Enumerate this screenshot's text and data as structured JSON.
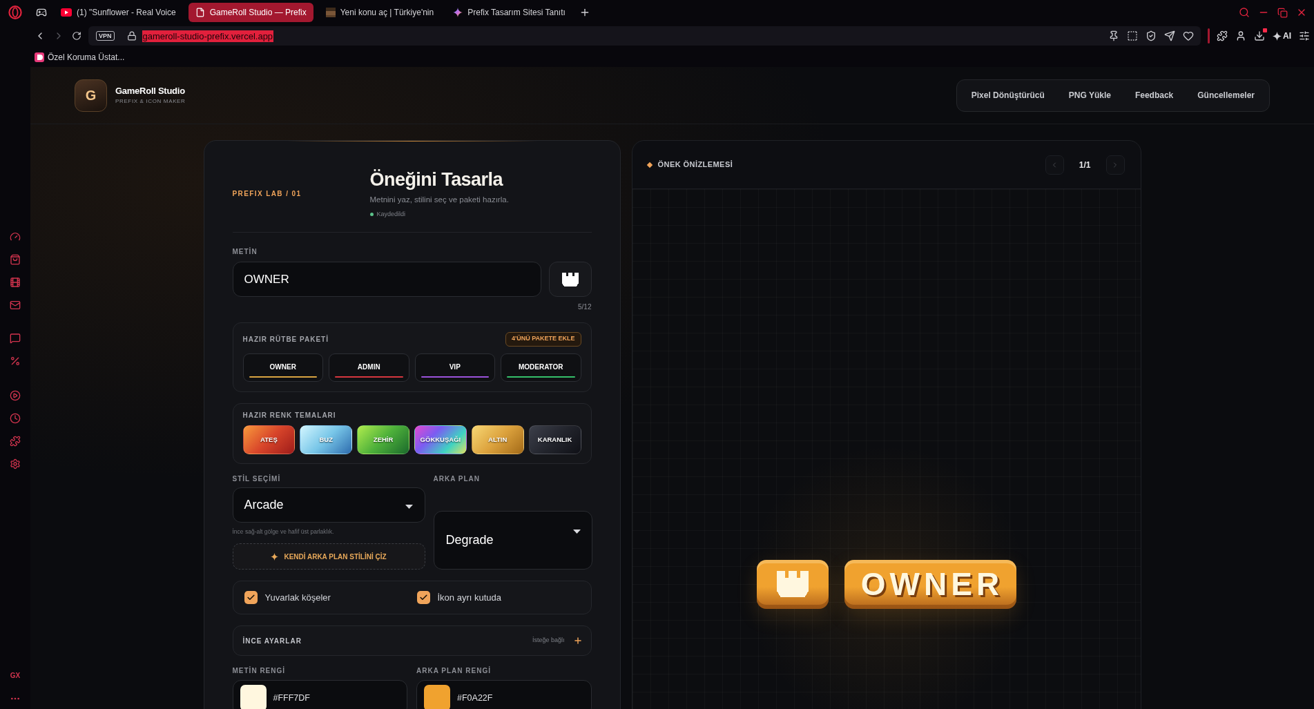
{
  "browser": {
    "tabs": [
      {
        "kind": "video",
        "title": "(1) \"Sunflower - Real Voice",
        "selected": false
      },
      {
        "kind": "page",
        "title": "GameRoll Studio — Prefix",
        "selected": true
      },
      {
        "kind": "game",
        "title": "Yeni konu aç | Türkiye'nin",
        "selected": false
      },
      {
        "kind": "ai",
        "title": "Prefix Tasarım Sitesi Tanıtı",
        "selected": false
      }
    ],
    "vpn": "VPN",
    "url": "gameroll-studio-prefix.vercel.app",
    "ai_label": "AI",
    "bookmarks": [
      "Özel Koruma Üstat..."
    ],
    "sidebar_label": "GX"
  },
  "header": {
    "logo_letter": "G",
    "title": "GameRoll Studio",
    "subtitle": "PREFIX & ICON MAKER",
    "nav": [
      "Pixel Dönüştürücü",
      "PNG Yükle",
      "Feedback",
      "Güncellemeler"
    ]
  },
  "editor": {
    "eyebrow": "PREFIX LAB / 01",
    "title": "Öneğini Tasarla",
    "subtitle": "Metnini yaz, stilini seç ve paketi hazırla.",
    "status": "Kaydedildi",
    "text_field": {
      "label": "METİN",
      "value": "OWNER",
      "counter": "5/12"
    },
    "rank_pack": {
      "title": "HAZIR RÜTBE PAKETİ",
      "add_button": "4'ÜNÜ PAKETE EKLE",
      "ranks": [
        {
          "label": "OWNER",
          "color": "#d9a441"
        },
        {
          "label": "ADMIN",
          "color": "#d6363f"
        },
        {
          "label": "VIP",
          "color": "#9b52dc"
        },
        {
          "label": "MODERATOR",
          "color": "#35c06a"
        }
      ]
    },
    "color_themes": {
      "title": "HAZIR RENK TEMALARI",
      "themes": [
        {
          "label": "ATEŞ",
          "kind": "fire"
        },
        {
          "label": "BUZ",
          "kind": "ice"
        },
        {
          "label": "ZEHİR",
          "kind": "poison"
        },
        {
          "label": "GÖKKUŞAĞI",
          "kind": "rainbow"
        },
        {
          "label": "ALTIN",
          "kind": "gold"
        },
        {
          "label": "KARANLIK",
          "kind": "dark"
        }
      ]
    },
    "style": {
      "label": "STİL SEÇİMİ",
      "value": "Arcade",
      "hint": "İnce sağ-alt gölge ve hafif üst parlaklık.",
      "draw_button": "KENDİ ARKA PLAN STİLİNİ ÇİZ"
    },
    "background": {
      "label": "ARKA PLAN",
      "value": "Degrade"
    },
    "options": [
      {
        "label": "Yuvarlak köşeler",
        "checked": true
      },
      {
        "label": "İkon ayrı kutuda",
        "checked": true
      }
    ],
    "fine_settings": {
      "title": "İNCE AYARLAR",
      "note": "İsteğe bağlı",
      "expanded": false
    },
    "colors": [
      {
        "label": "METİN RENGİ",
        "value": "#FFF7DF",
        "color": "#fff7df"
      },
      {
        "label": "ARKA PLAN RENGİ",
        "value": "#F0A22F",
        "color": "#f0a22f"
      }
    ]
  },
  "preview": {
    "title": "ÖNEK ÖNİZLEMESİ",
    "page": "1/1",
    "badge_text": "OWNER"
  }
}
